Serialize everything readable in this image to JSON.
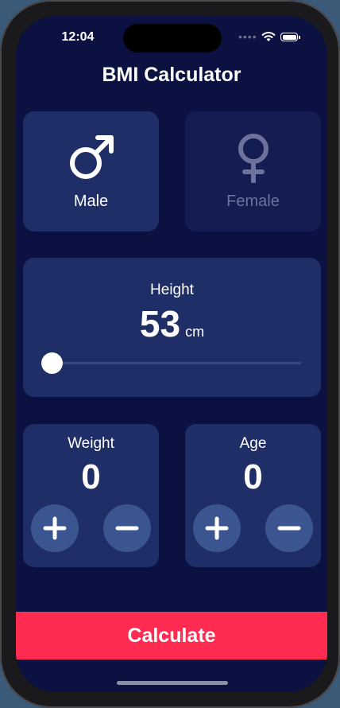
{
  "status_bar": {
    "time": "12:04",
    "signal_dots": "••••",
    "wifi_icon": "wifi-icon",
    "battery_icon": "battery-icon"
  },
  "app": {
    "title": "BMI Calculator"
  },
  "gender": {
    "male_label": "Male",
    "female_label": "Female",
    "male_icon": "male-symbol-icon",
    "female_icon": "female-symbol-icon",
    "selected": "Male"
  },
  "height": {
    "label": "Height",
    "value": "53",
    "unit": "cm",
    "slider_level": 0.0
  },
  "weight": {
    "label": "Weight",
    "value": "0",
    "plus_icon": "plus-icon",
    "minus_icon": "minus-icon"
  },
  "age": {
    "label": "Age",
    "value": "0",
    "plus_icon": "plus-icon",
    "minus_icon": "minus-icon"
  },
  "calculate_label": "Calculate",
  "colors": {
    "background": "#0b1140",
    "card_active": "#1f2e66",
    "card_inactive": "#141d52",
    "accent": "#ff2b50",
    "button": "#3b5590"
  }
}
